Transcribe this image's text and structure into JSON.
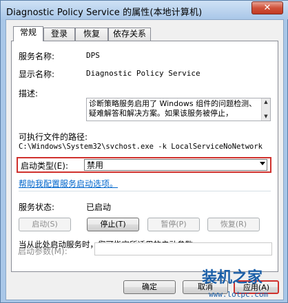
{
  "window": {
    "title": "Diagnostic Policy Service 的属性(本地计算机)",
    "close_glyph": "✕"
  },
  "tabs": [
    {
      "label": "常规",
      "active": true
    },
    {
      "label": "登录"
    },
    {
      "label": "恢复"
    },
    {
      "label": "依存关系"
    }
  ],
  "general": {
    "service_name_label": "服务名称:",
    "service_name": "DPS",
    "display_name_label": "显示名称:",
    "display_name": "Diagnostic Policy Service",
    "description_label": "描述:",
    "description": "诊断策略服务启用了 Windows 组件的问题检测、疑难解答和解决方案。如果该服务被停止，",
    "exe_path_label": "可执行文件的路径:",
    "exe_path": "C:\\Windows\\System32\\svchost.exe -k LocalServiceNoNetwork",
    "startup_type_label": "启动类型(E):",
    "startup_type_value": "禁用",
    "help_link": "帮助我配置服务启动选项。",
    "status_label": "服务状态:",
    "status_value": "已启动",
    "buttons": {
      "start": "启动(S)",
      "stop": "停止(T)",
      "pause": "暂停(P)",
      "resume": "恢复(R)"
    },
    "hint": "当从此处启动服务时，您可指定所适用的启动参数。",
    "start_params_label": "启动参数(M):",
    "start_params_value": ""
  },
  "footer": {
    "ok": "确定",
    "cancel": "取消",
    "apply": "应用(A)"
  },
  "watermark": {
    "text": "装机之家",
    "url": "www.lotpc.com"
  },
  "colors": {
    "highlight": "#d0312d",
    "link": "#0066cc",
    "watermark": "#1b5fa8"
  }
}
